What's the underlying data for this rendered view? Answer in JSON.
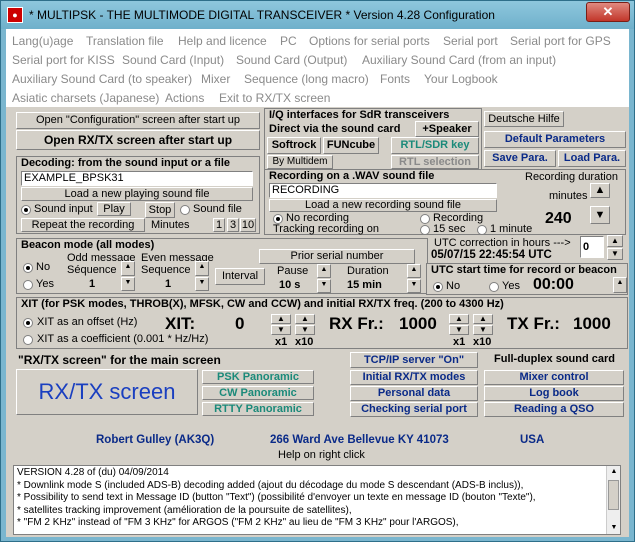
{
  "window": {
    "title": "* MULTIPSK - THE MULTIMODE DIGITAL TRANSCEIVER *   Version 4.28          Configuration",
    "close_label": "✕"
  },
  "menu": [
    "Lang(u)age",
    "Translation file",
    "Help and licence",
    "PC",
    "Options for serial ports",
    "Serial port",
    "Serial port for GPS",
    "Serial port for KISS",
    "Sound Card (Input)",
    "Sound Card (Output)",
    "Auxiliary Sound Card (from an input)",
    "Auxiliary Sound Card (to speaker)",
    "Mixer",
    "Sequence (long macro)",
    "Fonts",
    "Your Logbook",
    "Asiatic charsets (Japanese)",
    "Actions",
    "Exit to RX/TX screen"
  ],
  "startup": {
    "config_btn": "Open \"Configuration\" screen after start up",
    "rxtx_btn": "Open RX/TX screen after start up"
  },
  "sdr": {
    "title": "I/Q interfaces for SdR transceivers",
    "direct": "Direct via the sound card",
    "speaker": "+Speaker",
    "softrock": "Softrock",
    "funcube": "FUNcube",
    "rtl_sdr": "RTL/SDR key",
    "multidem": "By Multidem",
    "rtl_sel": "RTL selection"
  },
  "right_top": {
    "help": "Deutsche Hilfe",
    "defaults": "Default Parameters",
    "save": "Save Para.",
    "load": "Load Para."
  },
  "decoding": {
    "title": "Decoding: from the sound input or a file",
    "file_value": "EXAMPLE_BPSK31",
    "load_btn": "Load a new playing sound file",
    "sound_input": "Sound input",
    "play": "Play",
    "stop": "Stop",
    "sound_file": "Sound file",
    "repeat": "Repeat the recording",
    "minutes": "Minutes",
    "m1": "1",
    "m3": "3",
    "m10": "10"
  },
  "recording": {
    "title": "Recording on a .WAV sound file",
    "file_value": "RECORDING",
    "load_btn": "Load a new recording sound file",
    "no_rec": "No recording",
    "tracking": "Tracking recording on",
    "recording": "Recording",
    "s15": "15 sec",
    "m1": "1 minute",
    "duration_label": "Recording duration",
    "minutes": "minutes",
    "duration_value": "240"
  },
  "beacon": {
    "title": "Beacon mode (all modes)",
    "odd": "Odd message",
    "even": "Even message",
    "no": "No",
    "yes": "Yes",
    "seq1": "Séquence",
    "seq1_val": "1",
    "seq2": "Sequence",
    "seq2_val": "1",
    "interval": "Interval",
    "prior": "Prior serial number",
    "pause": "Pause",
    "pause_val": "10 s",
    "duration": "Duration",
    "duration_val": "15 min"
  },
  "utc": {
    "correction": "UTC correction in hours --->",
    "correction_val": "0",
    "datetime": "05/07/15  22:45:54  UTC",
    "start_title": "UTC start time for record or beacon",
    "no": "No",
    "yes": "Yes",
    "time": "00:00"
  },
  "xit": {
    "title": "XIT (for PSK modes, THROB(X), MFSK, CW and CCW) and initial RX/TX freq. (200 to 4300 Hz)",
    "offset": "XIT as an offset (Hz)",
    "coef": "XIT as a coefficient (0.001 * Hz/Hz)",
    "xit_label": "XIT:",
    "xit_val": "0",
    "rx_label": "RX Fr.:",
    "rx_val": "1000",
    "tx_label": "TX Fr.:",
    "tx_val": "1000",
    "x1": "x1",
    "x10": "x10"
  },
  "main_screen": {
    "title": "\"RX/TX screen\" for the main screen",
    "rxtx": "RX/TX screen",
    "psk": "PSK Panoramic",
    "cw": "CW Panoramic",
    "rtty": "RTTY Panoramic"
  },
  "tools": {
    "tcp": "TCP/IP server \"On\"",
    "modes": "Initial RX/TX modes",
    "personal": "Personal data",
    "checking": "Checking serial port",
    "duplex": "Full-duplex sound card",
    "mixer": "Mixer control",
    "logbook": "Log book",
    "qso": "Reading a QSO"
  },
  "station": {
    "name": "Robert Gulley (AK3Q)",
    "address": "266 Ward Ave Bellevue KY 41073",
    "country": "USA",
    "help_hint": "Help on right click"
  },
  "log_lines": [
    "VERSION 4.28 of (du) 04/09/2014",
    "* Downlink mode S (included ADS-B) decoding added (ajout du décodage du mode S descendant (ADS-B inclus)),",
    "* Possibility to send text in Message ID (button \"Text\") (possibilité d'envoyer un texte en message ID (bouton \"Texte\"),",
    "* satellites tracking improvement (amélioration de la poursuite de satellites),",
    "* \"FM 2 KHz\" instead of \"FM 3 KHz\" for ARGOS (\"FM 2 KHz\" au lieu de \"FM 3 KHz\" pour l'ARGOS),"
  ]
}
